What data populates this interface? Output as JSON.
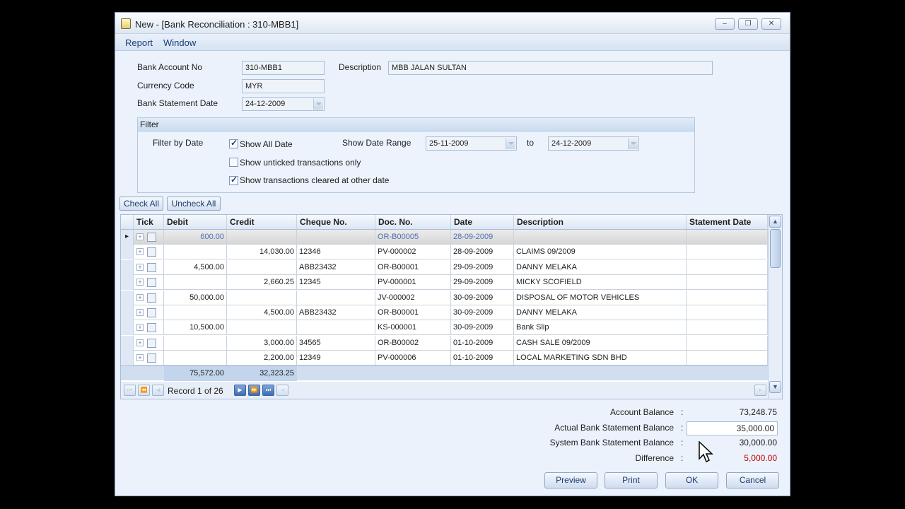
{
  "window": {
    "title": "New  - [Bank Reconciliation : 310-MBB1]",
    "controls": {
      "minimize": "–",
      "restore": "❐",
      "close": "✕"
    }
  },
  "menu": [
    "Report",
    "Window"
  ],
  "form": {
    "bank_account_label": "Bank Account No",
    "bank_account_value": "310-MBB1",
    "description_label": "Description",
    "description_value": "MBB JALAN SULTAN",
    "currency_label": "Currency Code",
    "currency_value": "MYR",
    "statement_date_label": "Bank Statement Date",
    "statement_date_value": "24-12-2009"
  },
  "filter": {
    "title": "Filter",
    "by_date_label": "Filter by Date",
    "show_all_date": {
      "label": "Show All Date",
      "checked": true
    },
    "show_unticked": {
      "label": "Show unticked transactions only",
      "checked": false
    },
    "show_cleared_other": {
      "label": "Show transactions cleared at other date",
      "checked": true
    },
    "date_range_label": "Show Date Range",
    "date_from": "25-11-2009",
    "to_label": "to",
    "date_to": "24-12-2009"
  },
  "toolbar": {
    "check_all": "Check All",
    "uncheck_all": "Uncheck All"
  },
  "grid": {
    "columns": [
      "Tick",
      "Debit",
      "Credit",
      "Cheque No.",
      "Doc. No.",
      "Date",
      "Description",
      "Statement Date"
    ],
    "rows": [
      {
        "debit": "600.00",
        "credit": "",
        "cheque": "",
        "doc": "OR-B00005",
        "date": "28-09-2009",
        "description": "",
        "statement_date": ""
      },
      {
        "debit": "",
        "credit": "14,030.00",
        "cheque": "12346",
        "doc": "PV-000002",
        "date": "28-09-2009",
        "description": "CLAIMS 09/2009",
        "statement_date": ""
      },
      {
        "debit": "4,500.00",
        "credit": "",
        "cheque": "ABB23432",
        "doc": "OR-B00001",
        "date": "29-09-2009",
        "description": "DANNY MELAKA",
        "statement_date": ""
      },
      {
        "debit": "",
        "credit": "2,660.25",
        "cheque": "12345",
        "doc": "PV-000001",
        "date": "29-09-2009",
        "description": "MICKY SCOFIELD",
        "statement_date": ""
      },
      {
        "debit": "50,000.00",
        "credit": "",
        "cheque": "",
        "doc": "JV-000002",
        "date": "30-09-2009",
        "description": "DISPOSAL OF MOTOR VEHICLES",
        "statement_date": ""
      },
      {
        "debit": "",
        "credit": "4,500.00",
        "cheque": "ABB23432",
        "doc": "OR-B00001",
        "date": "30-09-2009",
        "description": "DANNY MELAKA",
        "statement_date": ""
      },
      {
        "debit": "10,500.00",
        "credit": "",
        "cheque": "",
        "doc": "KS-000001",
        "date": "30-09-2009",
        "description": "Bank Slip",
        "statement_date": ""
      },
      {
        "debit": "",
        "credit": "3,000.00",
        "cheque": "34565",
        "doc": "OR-B00002",
        "date": "01-10-2009",
        "description": "CASH SALE 09/2009",
        "statement_date": ""
      },
      {
        "debit": "",
        "credit": "2,200.00",
        "cheque": "12349",
        "doc": "PV-000006",
        "date": "01-10-2009",
        "description": "LOCAL MARKETING SDN BHD",
        "statement_date": ""
      }
    ],
    "total_debit": "75,572.00",
    "total_credit": "32,323.25",
    "record_text": "Record 1 of 26"
  },
  "balances": {
    "account_balance_label": "Account Balance",
    "account_balance": "73,248.75",
    "actual_statement_label": "Actual Bank Statement Balance",
    "actual_statement": "35,000.00",
    "system_statement_label": "System Bank Statement Balance",
    "system_statement": "30,000.00",
    "difference_label": "Difference",
    "difference": "5,000.00",
    "colon": ":",
    "difference_color": "#c00000"
  },
  "buttons": {
    "preview": "Preview",
    "print": "Print",
    "ok": "OK",
    "cancel": "Cancel"
  }
}
